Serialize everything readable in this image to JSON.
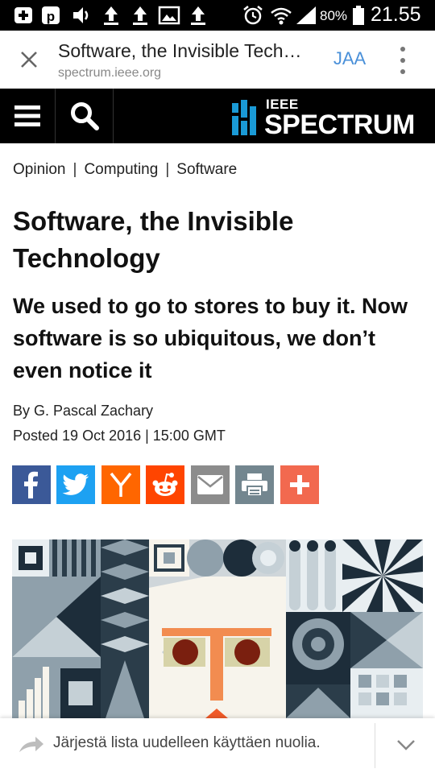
{
  "status_bar": {
    "battery_percent": "80%",
    "time": "21.55",
    "icons": [
      "plus-box-icon",
      "p-box-icon",
      "volume-icon",
      "upload-icon",
      "upload-icon",
      "image-icon",
      "upload-icon",
      "alarm-icon",
      "wifi-icon",
      "signal-icon",
      "battery-icon"
    ]
  },
  "tab": {
    "title": "Software, the Invisible Tech…",
    "url": "spectrum.ieee.org",
    "share_label": "JAA"
  },
  "site": {
    "logo_top": "IEEE",
    "logo_bottom": "SPECTRUM"
  },
  "article": {
    "breadcrumbs": [
      "Opinion",
      "Computing",
      "Software"
    ],
    "headline": "Software, the Invisible Technology",
    "subhead": "We used to go to stores to buy it. Now software is so ubiquitous, we don’t even notice it",
    "byline": "By G. Pascal Zachary",
    "posted": "Posted 19 Oct 2016 | 15:00 GMT"
  },
  "share_buttons": [
    {
      "name": "facebook",
      "color": "#3b5998"
    },
    {
      "name": "twitter",
      "color": "#1da1f2"
    },
    {
      "name": "hacker-news",
      "color": "#ff6600"
    },
    {
      "name": "reddit",
      "color": "#ff4500"
    },
    {
      "name": "email",
      "color": "#8c8c8c"
    },
    {
      "name": "print",
      "color": "#73868f"
    },
    {
      "name": "more",
      "color": "#f2694f"
    }
  ],
  "reorder_bar": {
    "text": "Järjestä lista uudelleen käyttäen nuolia."
  }
}
